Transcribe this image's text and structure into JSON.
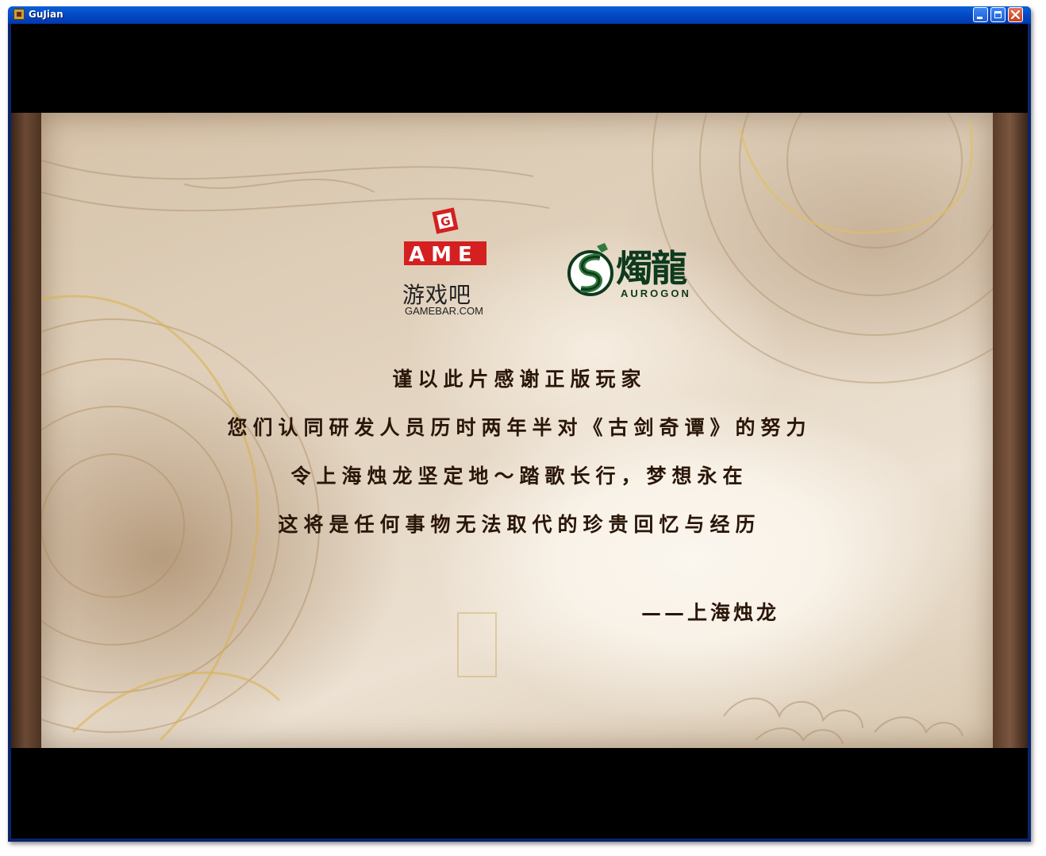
{
  "window": {
    "title": "GuJian",
    "controls": {
      "minimize": "minimize-icon",
      "maximize": "maximize-icon",
      "close": "close-icon"
    }
  },
  "logos": {
    "gamebar": {
      "mark": "AME",
      "chinese": "游戏吧",
      "url_text": "GAMEBAR.COM"
    },
    "aurogon": {
      "chinese": "燭龍",
      "english": "AUROGON"
    }
  },
  "message": {
    "lines": [
      "谨以此片感谢正版玩家",
      "您们认同研发人员历时两年半对《古剑奇谭》的努力",
      "令上海烛龙坚定地～踏歌长行，梦想永在",
      "这将是任何事物无法取代的珍贵回忆与经历"
    ],
    "signature": "——上海烛龙"
  },
  "colors": {
    "titlebar": "#0449c4",
    "letterbox": "#000000",
    "ink": "#2a1608",
    "gamebar_red": "#d42020",
    "aurogon_green": "#0e3a1e"
  }
}
